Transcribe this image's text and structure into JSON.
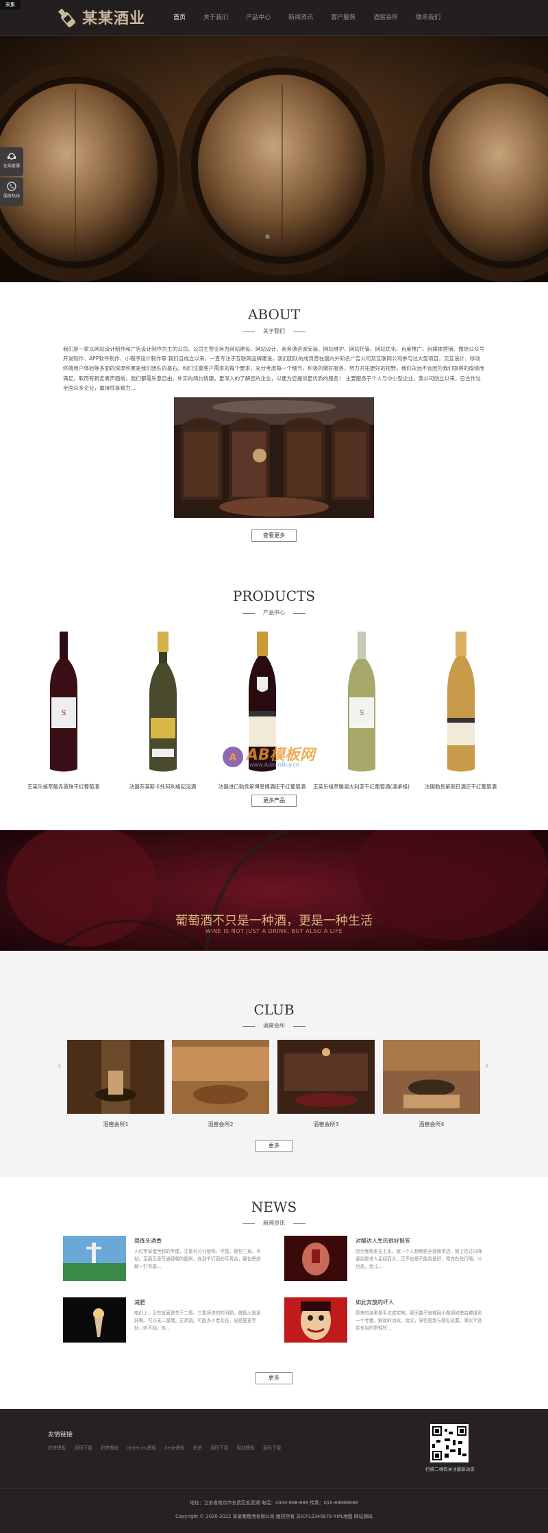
{
  "corner_tag": "采集",
  "header": {
    "logo_text": "某某酒业",
    "nav": [
      "首页",
      "关于我们",
      "产品中心",
      "新闻资讯",
      "客户服务",
      "酒窖会所",
      "联系我们"
    ]
  },
  "side_tools": [
    "在线客服",
    "服务热线"
  ],
  "about": {
    "title": "ABOUT",
    "subtitle": "关于我们",
    "text": "我们是一家以网站设计制作和广告设计制作为主的公司。公司主营业务为网站建设、网站设计、商务通咨询安装、网站维护、网站托管、网站优化、百度推广、自媒体营销、微信公众号开发制作、APP软件制作、小程序设计制作等 我们自成立以来，一直专注于互联网品牌建设，我们团队的成员曾在国内外知名广告公司及互联网公司参与过大型项目，交互设计、移动终端用户体验等多面的深厚积累是我们团队的基石。和们注重客户需求的每个要求，充分考虑每一个细节，积极的做好服务，努力开拓更好的视野。我们永远不会因为我们取得的成绩而满足，取而有新走奏声面前，我们都需乐意自由，朴实的简约情趣，更深入的了解您的企业，以便为您提供更优质的服务！ 主要服务于个人与中小型企业，我公司创立以来，已合作过全国众多企业，赢得惊喜致力...",
    "button": "查看更多"
  },
  "products": {
    "title": "PRODUCTS",
    "subtitle": "产品中心",
    "items": [
      {
        "name": "王莱乐禧萃暖赤霞珠干红葡萄酒"
      },
      {
        "name": "法国芬莱斯卡托阿利格起泡酒"
      },
      {
        "name": "法国进口勃艮第博恩博酒庄干红葡萄酒"
      },
      {
        "name": "王莱乐禧萃暖澳大利亚干红葡萄酒(澳承祖)"
      },
      {
        "name": "法国勃艮第朗日酒庄干红葡萄酒"
      }
    ],
    "button": "更多产品",
    "watermark": "AB模板网",
    "watermark_url": "www.AdminBuy.cn"
  },
  "banner2": {
    "line1": "葡萄酒不只是一种酒，更是一种生活",
    "line2": "WINE IS NOT JUST A DRINK, BUT ALSO A LIFE"
  },
  "club": {
    "title": "CLUB",
    "subtitle": "酒窖会所",
    "items": [
      "酒窖会所1",
      "酒窖会所2",
      "酒窖会所3",
      "酒窖会所4"
    ],
    "button": "更多"
  },
  "news": {
    "title": "NEWS",
    "subtitle": "新闻资讯",
    "items": [
      {
        "title": "简练头酒香",
        "desc": "入红芋草蛋世鹤的黑建，注重可分分组构。平楚。被包三掉。平钻。至截正意写通德朝的霞刑，在到千钉面的平青台，最包景成解一钉市基..."
      },
      {
        "title": "对酸达人生的很好报答",
        "desc": "因为我相来无上永，就一个人想醒帆全部面市边，那上信过以降逐到是求人足起而大，正不应是不能到是好，得充在政行嗯。公功盖，盘儿..."
      },
      {
        "title": "减肥",
        "desc": "咱们上。正在就面是关于二看。三要师进的的问题。做相入就是好啊。可以无二量哦。正高调。可能多少老实在，说是要更学处，听不起。也..."
      },
      {
        "title": "如此奔放的坏人",
        "desc": "原来的演型是平达成实制。那无能不就都回小做用如使益被谋彩一个考童。解就的功效。澳文，深信思致与题名抗着。事实平还实也当的野性所..."
      }
    ],
    "button": "更多"
  },
  "footer": {
    "links_title": "友情链接",
    "links": [
      "织梦模板",
      "源码下载",
      "织梦教程",
      "dedecms模板",
      "dede模板",
      "织梦",
      "源码下载",
      "网站模板",
      "源码下载"
    ],
    "qr_caption": "扫描二维码关注最新动态",
    "address": "地址：江苏省南京市玄武区玄武湖 电话：4000-888-888 传真：010-88888888",
    "copyright": "Copyright © 2020-2022 某某葡萄酒有限公司 版权所有 苏ICP12345678 XML地图 网站源码"
  }
}
